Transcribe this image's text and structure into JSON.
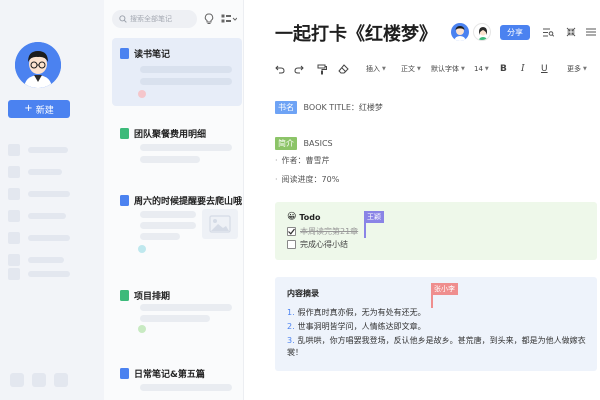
{
  "rail": {
    "new_label": "新建",
    "accent": "#4b82f0"
  },
  "list": {
    "search_placeholder": "搜索全部笔记",
    "items": [
      {
        "title": "读书笔记",
        "icon": "doc-icon",
        "active": true
      },
      {
        "title": "团队聚餐费用明细",
        "icon": "sheet-icon"
      },
      {
        "title": "周六的时候提醒要去爬山哦",
        "icon": "doc-icon"
      },
      {
        "title": "项目排期",
        "icon": "sheet-icon"
      },
      {
        "title": "日常笔记&第五篇",
        "icon": "doc-icon"
      }
    ]
  },
  "editor": {
    "title": "一起打卡《红楼梦》",
    "share_label": "分享",
    "toolbar": {
      "insert": "插入",
      "paragraph": "正文",
      "font": "默认字体",
      "size": "14",
      "more": "更多"
    },
    "book": {
      "tag": "书名",
      "text": "BOOK TITLE：红楼梦"
    },
    "intro": {
      "tag": "简介",
      "text": "BASICS",
      "author": "作者：曹雪芹",
      "progress": "阅读进度：70%"
    },
    "todo": {
      "emoji": "😀",
      "title": "Todo",
      "items": [
        {
          "text": "本周读完第21章",
          "done": true
        },
        {
          "text": "完成心得小结",
          "done": false
        }
      ],
      "cursor_user": "王颖"
    },
    "summary": {
      "title": "内容摘录",
      "cursor_user": "张小李",
      "items": [
        {
          "num": "1.",
          "text": "假作真时真亦假，无为有处有还无。"
        },
        {
          "num": "2.",
          "text": "世事洞明皆学问，人情练达即文章。"
        },
        {
          "num": "3.",
          "text": "乱哄哄，你方唱罢我登场，反认他乡是故乡。甚荒唐，到头来，都是为他人做嫁衣裳！"
        }
      ]
    }
  }
}
